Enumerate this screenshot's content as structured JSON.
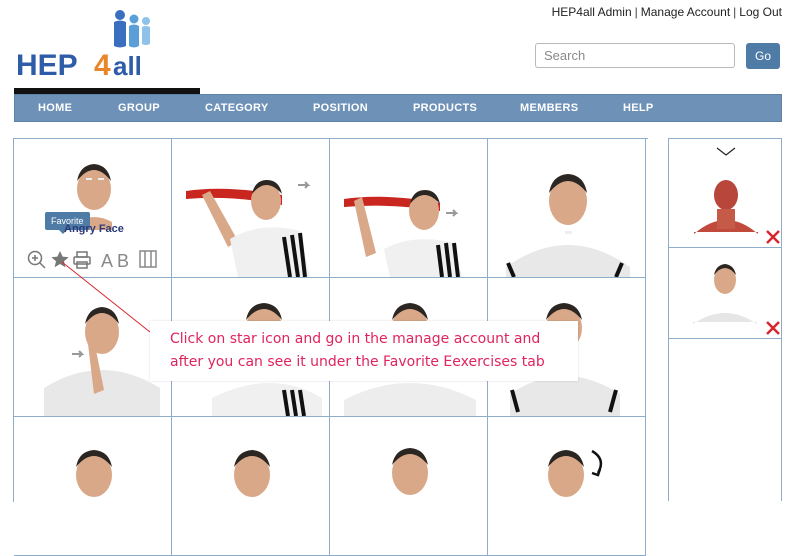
{
  "brand": {
    "logo_text_hep": "HEP",
    "logo_text_4": "4",
    "logo_text_all": "all",
    "logo_name": "hep4all-logo"
  },
  "top_links": {
    "admin": "HEP4all Admin",
    "separator": "|",
    "manage_account": "Manage Account",
    "logout": "Log Out"
  },
  "search": {
    "placeholder": "Search",
    "value": "",
    "button": "Go"
  },
  "nav": {
    "items": [
      "HOME",
      "GROUP",
      "CATEGORY",
      "POSITION",
      "PRODUCTS",
      "MEMBERS",
      "HELP"
    ]
  },
  "exercise_card": {
    "title": "Angry Face",
    "tooltip": "Favorite",
    "icons": [
      "zoom-in-icon",
      "star-icon",
      "print-icon",
      "text-label-icon",
      "layout-icon"
    ],
    "icon_text": "A B"
  },
  "callout": {
    "line1": "Click on star icon and go in the manage account and",
    "line2": "after you can see it under the Favorite Eexercises tab"
  },
  "colors": {
    "nav": "#6e91b7",
    "grid_border": "#8eaccb",
    "callout_text": "#e0245e",
    "remove_x": "#d8262e",
    "title": "#2a3a7a"
  }
}
